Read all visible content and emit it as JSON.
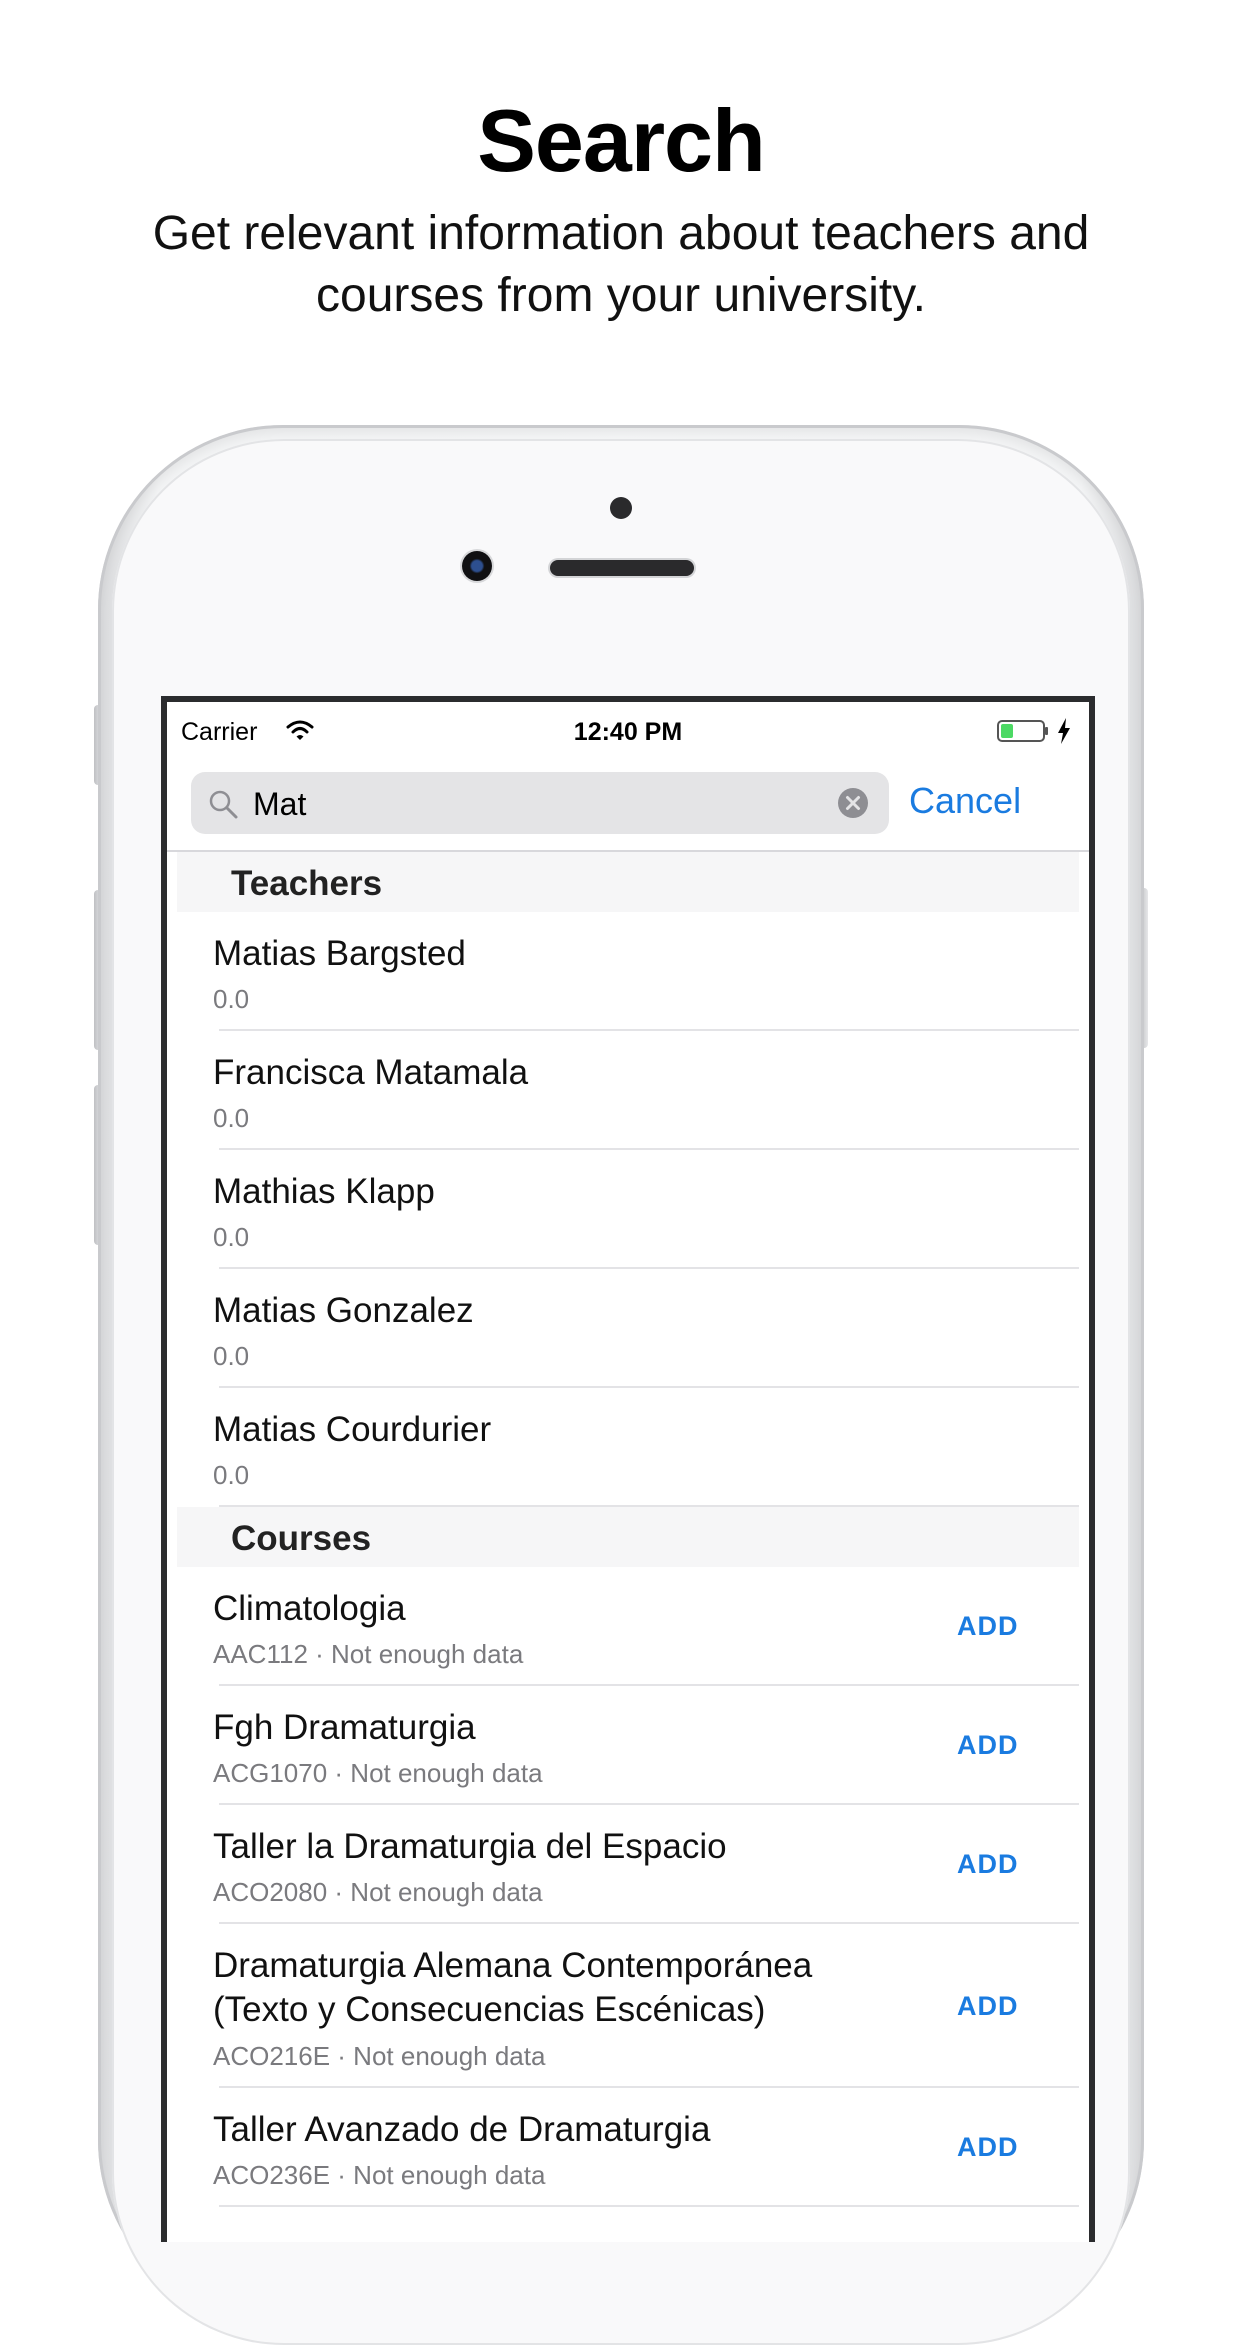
{
  "header": {
    "title": "Search",
    "subtitle_line1": "Get relevant information about teachers and",
    "subtitle_line2": "courses from your university."
  },
  "status_bar": {
    "carrier": "Carrier",
    "time": "12:40 PM",
    "battery_level": 0.3
  },
  "search": {
    "query": "Mat",
    "cancel_label": "Cancel"
  },
  "colors": {
    "accent": "#1a7be0",
    "battery": "#4cd964"
  },
  "teachers": {
    "section_label": "Teachers",
    "items": [
      {
        "name": "Matias Bargsted",
        "rating": "0.0"
      },
      {
        "name": "Francisca Matamala",
        "rating": "0.0"
      },
      {
        "name": "Mathias Klapp",
        "rating": "0.0"
      },
      {
        "name": "Matias Gonzalez",
        "rating": "0.0"
      },
      {
        "name": "Matias Courdurier",
        "rating": "0.0"
      }
    ]
  },
  "courses": {
    "section_label": "Courses",
    "add_label": "ADD",
    "items": [
      {
        "name": "Climatologia",
        "detail": "AAC112 · Not enough data"
      },
      {
        "name": "Fgh Dramaturgia",
        "detail": "ACG1070 · Not enough data"
      },
      {
        "name": "Taller la Dramaturgia del Espacio",
        "detail": "ACO2080 · Not enough data"
      },
      {
        "name": "Dramaturgia Alemana Contemporánea (Texto y Consecuencias Escénicas)",
        "detail": "ACO216E · Not enough data"
      },
      {
        "name": "Taller Avanzado de Dramaturgia",
        "detail": "ACO236E · Not enough data"
      }
    ]
  }
}
